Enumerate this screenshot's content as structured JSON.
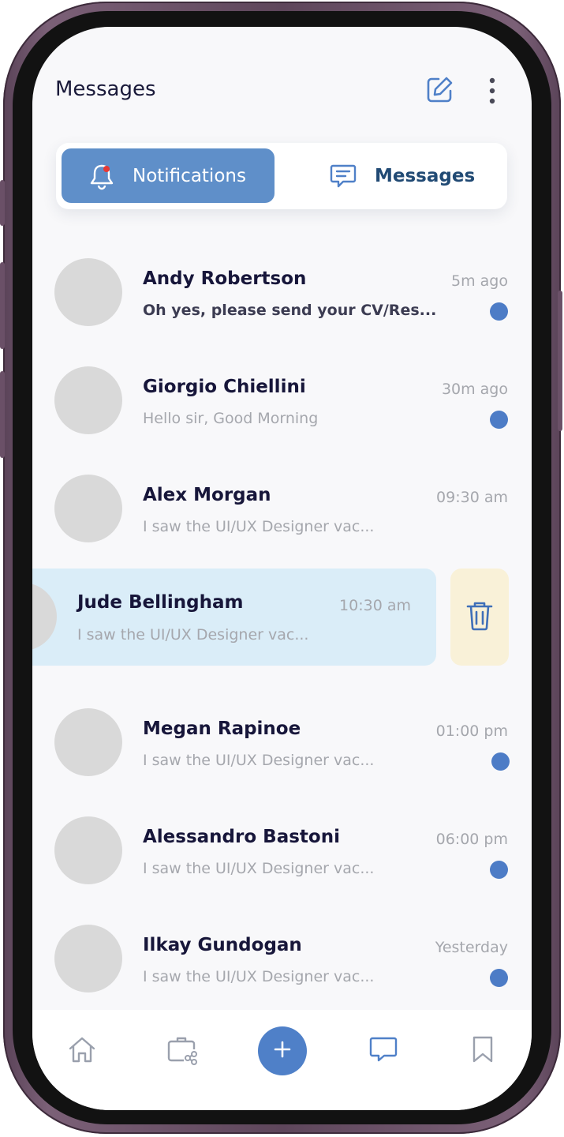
{
  "header": {
    "title": "Messages",
    "compose_icon": "compose-icon",
    "more_icon": "more-vertical-icon"
  },
  "tabs": [
    {
      "label": "Notifications",
      "icon": "bell-icon",
      "active": true
    },
    {
      "label": "Messages",
      "icon": "message-icon",
      "active": false
    }
  ],
  "conversations": [
    {
      "name": "Andy Robertson",
      "preview": "Oh yes, please send your CV/Res...",
      "time": "5m ago",
      "unread": true
    },
    {
      "name": "Giorgio Chiellini",
      "preview": "Hello sir, Good Morning",
      "time": "30m ago",
      "unread": true
    },
    {
      "name": "Alex Morgan",
      "preview": "I saw the UI/UX Designer vac...",
      "time": "09:30 am",
      "unread": false
    },
    {
      "name": "Jude Bellingham",
      "preview": "I saw the UI/UX Designer vac...",
      "time": "10:30 am",
      "unread": false,
      "swiped": true
    },
    {
      "name": "Megan Rapinoe",
      "preview": "I saw the UI/UX Designer vac...",
      "time": "01:00 pm",
      "unread": true
    },
    {
      "name": "Alessandro Bastoni",
      "preview": "I saw the UI/UX Designer vac...",
      "time": "06:00 pm",
      "unread": true
    },
    {
      "name": "Ilkay Gundogan",
      "preview": "I saw the UI/UX Designer vac...",
      "time": "Yesterday",
      "unread": true
    }
  ],
  "swipe_action": {
    "icon": "trash-icon"
  },
  "bottom_nav": {
    "items": [
      "home-icon",
      "briefcase-share-icon",
      "plus-icon",
      "chat-icon",
      "bookmark-icon"
    ]
  },
  "colors": {
    "accent": "#5f8fc9",
    "unread_dot": "#4d7cc6",
    "swiped_row": "#daedf8",
    "delete_bg": "#f9f1d8",
    "notification_badge": "#e53935"
  }
}
